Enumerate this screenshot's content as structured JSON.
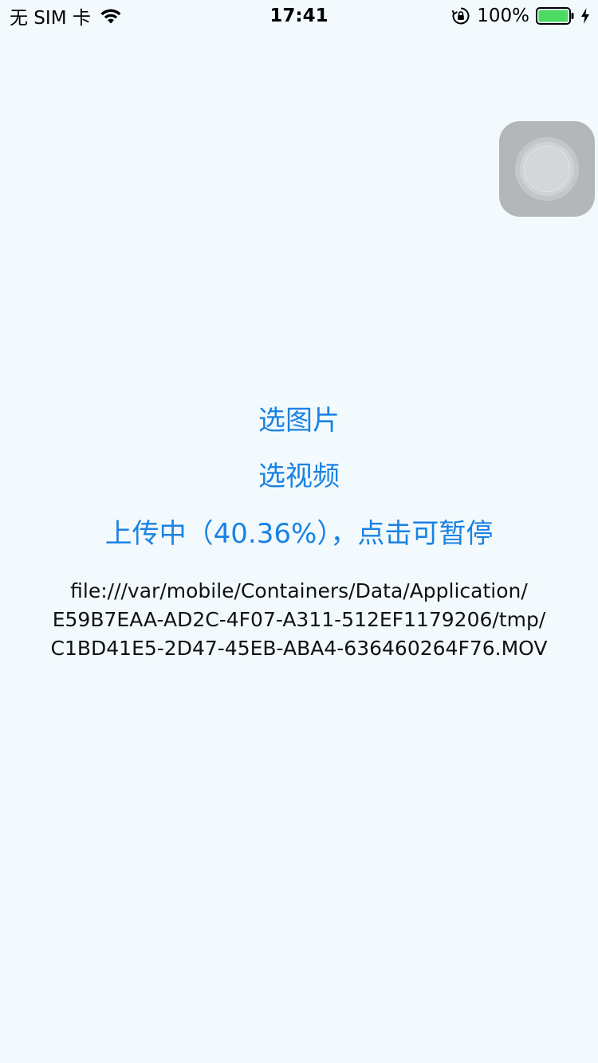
{
  "status_bar": {
    "carrier": "无 SIM 卡",
    "time": "17:41",
    "battery_percent": "100%",
    "battery_level": 1.0,
    "battery_color": "#4CD964",
    "icons": [
      "wifi-icon",
      "lock-rotation-icon",
      "battery-icon",
      "charging-icon"
    ]
  },
  "assistive_touch": {
    "icon": "assistive-touch-icon"
  },
  "main": {
    "pick_image_label": "选图片",
    "pick_video_label": "选视频",
    "upload_status_label": "上传中（40.36%），点击可暂停",
    "upload_progress_percent": 40.36,
    "file_path_lines": [
      "file:///var/mobile/Containers/Data/Application/",
      "E59B7EAA-AD2C-4F07-A311-512EF1179206/tmp/",
      "C1BD41E5-2D47-45EB-ABA4-636460264F76.MOV"
    ]
  },
  "colors": {
    "background": "#F3FAFE",
    "accent": "#1A82E2"
  }
}
